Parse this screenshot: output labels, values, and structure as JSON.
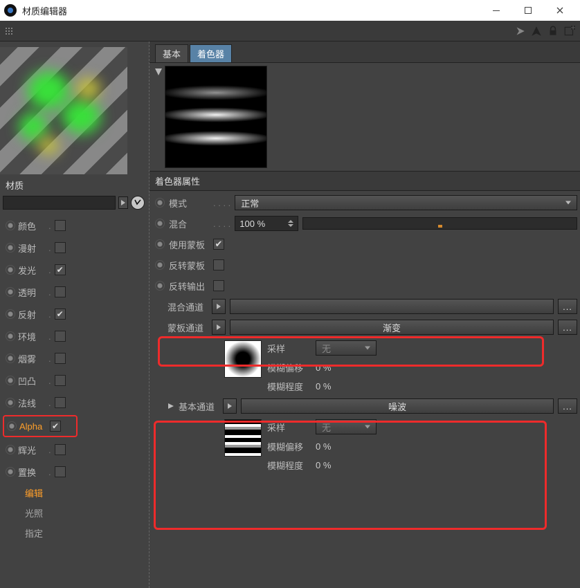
{
  "window": {
    "title": "材质编辑器"
  },
  "left": {
    "material_label": "材质",
    "channels": [
      {
        "id": "color",
        "label": "颜色",
        "checked": false
      },
      {
        "id": "diffuse",
        "label": "漫射",
        "checked": false
      },
      {
        "id": "luminance",
        "label": "发光",
        "checked": true
      },
      {
        "id": "transparency",
        "label": "透明",
        "checked": false
      },
      {
        "id": "reflection",
        "label": "反射",
        "checked": true
      },
      {
        "id": "environment",
        "label": "环境",
        "checked": false
      },
      {
        "id": "fog",
        "label": "烟雾",
        "checked": false
      },
      {
        "id": "bump",
        "label": "凹凸",
        "checked": false
      },
      {
        "id": "normal",
        "label": "法线",
        "checked": false
      },
      {
        "id": "alpha",
        "label": "Alpha",
        "checked": true,
        "selected": true
      },
      {
        "id": "glow",
        "label": "辉光",
        "checked": false
      },
      {
        "id": "displacement",
        "label": "置换",
        "checked": false
      }
    ],
    "sub": [
      {
        "id": "edit",
        "label": "编辑",
        "active": true
      },
      {
        "id": "illum",
        "label": "光照"
      },
      {
        "id": "assign",
        "label": "指定"
      }
    ]
  },
  "tabs": [
    {
      "id": "basic",
      "label": "基本"
    },
    {
      "id": "shader",
      "label": "着色器",
      "active": true
    }
  ],
  "section_title": "着色器属性",
  "props": {
    "mode": {
      "label": "模式",
      "value": "正常"
    },
    "mix": {
      "label": "混合",
      "value": "100 %"
    },
    "use_mask": {
      "label": "使用蒙板",
      "checked": true
    },
    "inv_mask": {
      "label": "反转蒙板",
      "checked": false
    },
    "inv_out": {
      "label": "反转输出",
      "checked": false
    }
  },
  "mix_channel": {
    "label": "混合通道",
    "slot": ""
  },
  "mask_channel": {
    "label": "蒙板通道",
    "slot": "渐变"
  },
  "base_channel": {
    "label": "基本通道",
    "slot": "噪波"
  },
  "sample": {
    "label": "采样",
    "value": "无",
    "blur_offset_label": "模糊偏移",
    "blur_offset": "0 %",
    "blur_scale_label": "模糊程度",
    "blur_scale": "0 %"
  }
}
